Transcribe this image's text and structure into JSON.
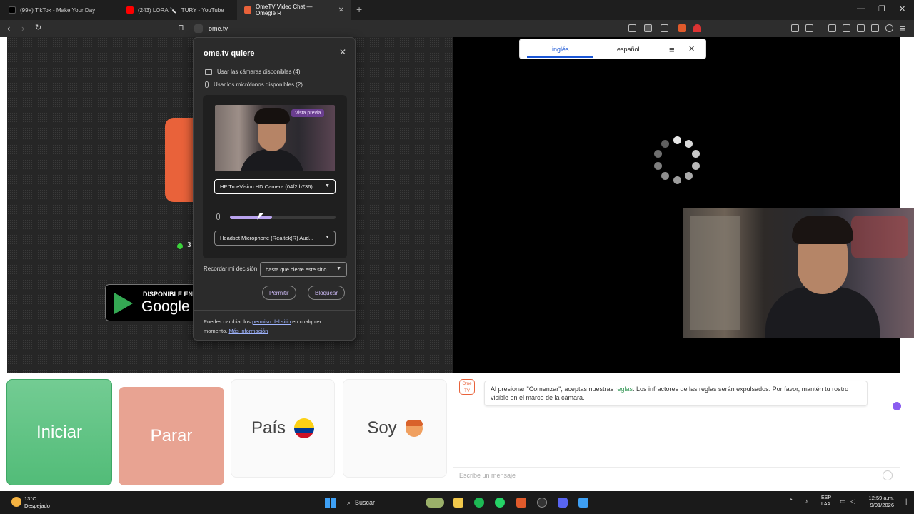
{
  "browser": {
    "tabs": [
      {
        "label": "(99+) TikTok - Make Your Day",
        "color": "#000000"
      },
      {
        "label": "(243) LORA 🔪 | TURY - YouTube",
        "color": "#ff0000"
      },
      {
        "label": "OmeTV Video Chat — Omegle R",
        "color": "#e9623a",
        "active": true
      }
    ],
    "url": "ome.tv"
  },
  "left_panel": {
    "online_count": "3",
    "store_badge": {
      "line1": "DISPONIBLE EN",
      "line2": "Google"
    }
  },
  "translate_bar": {
    "lang_from": "inglés",
    "lang_to": "español"
  },
  "permission_popup": {
    "title": "ome.tv quiere",
    "cameras": "Usar las cámaras disponibles (4)",
    "microphones": "Usar los micrófonos disponibles (2)",
    "preview_label": "Vista previa",
    "camera_select": "HP TrueVision HD Camera (04f2:b736)",
    "mic_level": 0.4,
    "mic_select": "Headset Microphone (Realtek(R) Aud...",
    "remember_label": "Recordar mi decisión",
    "remember_select": "hasta que cierre este sitio",
    "allow_button": "Permitir",
    "block_button": "Bloquear",
    "footer_before": "Puedes cambiar los ",
    "footer_link": "permiso del sitio",
    "footer_after": " en cualquier momento. ",
    "footer_more": "Más información"
  },
  "buttons": {
    "start": "Iniciar",
    "stop": "Parar",
    "country": "País",
    "gender": "Soy"
  },
  "chat": {
    "logo_text": "Ome TV",
    "msg_before": "Al presionar \"Comenzar\", aceptas nuestras ",
    "msg_link": "reglas",
    "msg_after": ". Los infractores de las reglas serán expulsados. Por favor, mantén tu rostro visible en el marco de la cámara.",
    "input_placeholder": "Escribe un mensaje"
  },
  "taskbar": {
    "temperature": "13°C",
    "weather": "Despejado",
    "search": "Buscar",
    "lang_line1": "ESP",
    "lang_line2": "LAA",
    "time": "12:59 a.m.",
    "date": "9/01/2026"
  },
  "colors": {
    "start": "#5cc283",
    "stop": "#e8a392",
    "brand": "#e9623a",
    "accent": "#b9a3ee"
  }
}
